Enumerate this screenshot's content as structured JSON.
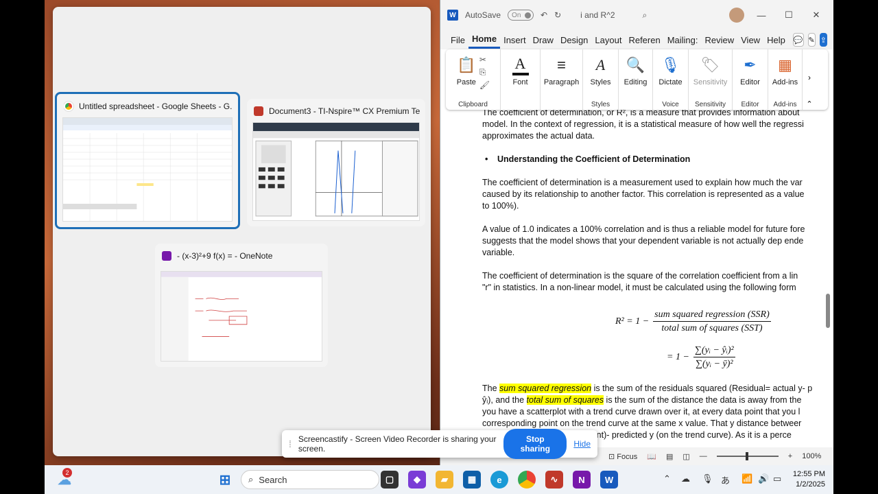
{
  "switcher": {
    "windows": [
      {
        "title": "Untitled spreadsheet - Google Sheets - G...",
        "app": "chrome"
      },
      {
        "title": "Document3 - TI-Nspire™ CX Premium Tea...",
        "app": "nspire"
      },
      {
        "title": "- (x-3)²+9 f(x) = - OneNote",
        "app": "onenote"
      }
    ]
  },
  "word": {
    "autosave_label": "AutoSave",
    "autosave_state": "On",
    "doc_title": "i and R^2",
    "menu": [
      "File",
      "Home",
      "Insert",
      "Draw",
      "Design",
      "Layout",
      "Referen",
      "Mailing:",
      "Review",
      "View",
      "Help"
    ],
    "ribbon": {
      "paste": "Paste",
      "clipboard_group": "Clipboard",
      "font": "Font",
      "paragraph": "Paragraph",
      "styles": "Styles",
      "styles_group": "Styles",
      "editing": "Editing",
      "dictate": "Dictate",
      "voice_group": "Voice",
      "sensitivity": "Sensitivity",
      "sensitivity_group": "Sensitivity",
      "editor": "Editor",
      "editor_group": "Editor",
      "addins": "Add-ins",
      "addins_group": "Add-ins"
    },
    "doc": {
      "intro_1": "The coefficient of determination, or R², is a measure that provides information about",
      "intro_2": "model. In the context of regression, it is a statistical measure of how well the regressi",
      "intro_3": "approximates the actual data.",
      "heading": "Understanding the Coefficient of Determination",
      "p1_1": "The coefficient of determination is a measurement used to explain how much the var",
      "p1_2": "caused by its relationship to another factor. This correlation is represented as a value",
      "p1_3": "to 100%).",
      "p2_1": "A value of 1.0 indicates a 100% correlation and is thus a reliable model for future fore",
      "p2_2": "suggests that the model shows that your dependent variable is not actually dep ende",
      "p2_3": "variable.",
      "p3_1": "The coefficient of determination is the square of the correlation coefficient from a lin",
      "p3_2": "\"r\" in statistics.  In a non-linear model, it must be calculated using the following form",
      "eq1_lhs": "R² = 1 −",
      "eq1_num": "sum squared regression (SSR)",
      "eq1_den": "total sum of squares (SST)",
      "eq2_lhs": "= 1 −",
      "eq2_num": "∑(yᵢ − ŷᵢ)²",
      "eq2_den": "∑(yᵢ − ȳ)²",
      "p4_a": "The ",
      "p4_hl1": "sum squared regression",
      "p4_b": " is the sum of the residuals squared (Residual= actual y- p",
      "p4_c": "ŷᵢ), and the ",
      "p4_hl2": "total sum of squares",
      "p4_d": " is the sum of the distance the data is away from the",
      "p4_e": "you have a scatterplot with a trend curve drawn over it, at every data point that you l",
      "p4_f": "corresponding point on the trend curve at the same x value.  That y distance betweer",
      "p4_g": "point)- predicted y (on the trend curve).  As it is a perce"
    },
    "status": {
      "focus": "Focus",
      "zoom": "100%"
    }
  },
  "sharebar": {
    "message": "Screencastify - Screen Video Recorder is sharing your screen.",
    "stop_label": "Stop sharing",
    "hide_label": "Hide"
  },
  "taskbar": {
    "search_placeholder": "Search",
    "weather_badge": "2",
    "time": "12:55 PM",
    "date": "1/2/2025"
  }
}
